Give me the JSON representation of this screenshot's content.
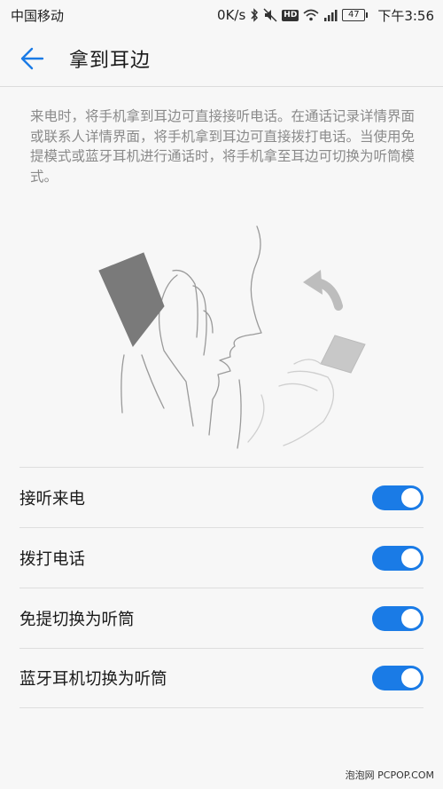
{
  "status_bar": {
    "carrier": "中国移动",
    "speed": "0K/s",
    "battery": "47",
    "time": "下午3:56",
    "icons": [
      "bluetooth-icon",
      "mute-icon",
      "hd-icon",
      "wifi-icon",
      "signal-icon",
      "battery-icon"
    ]
  },
  "header": {
    "title": "拿到耳边",
    "back_icon": "arrow-left-icon"
  },
  "description": "来电时，将手机拿到耳边可直接接听电话。在通话记录详情界面或联系人详情界面，将手机拿到耳边可直接拨打电话。当使用免提模式或蓝牙耳机进行通话时，将手机拿至耳边可切换为听筒模式。",
  "settings": [
    {
      "label": "接听来电",
      "enabled": true
    },
    {
      "label": "拨打电话",
      "enabled": true
    },
    {
      "label": "免提切换为听筒",
      "enabled": true
    },
    {
      "label": "蓝牙耳机切换为听筒",
      "enabled": true
    }
  ],
  "watermark": "泡泡网 PCPOP.COM",
  "colors": {
    "accent": "#1a7be6",
    "background": "#f7f7f7",
    "description_text": "#8a8a8a"
  }
}
